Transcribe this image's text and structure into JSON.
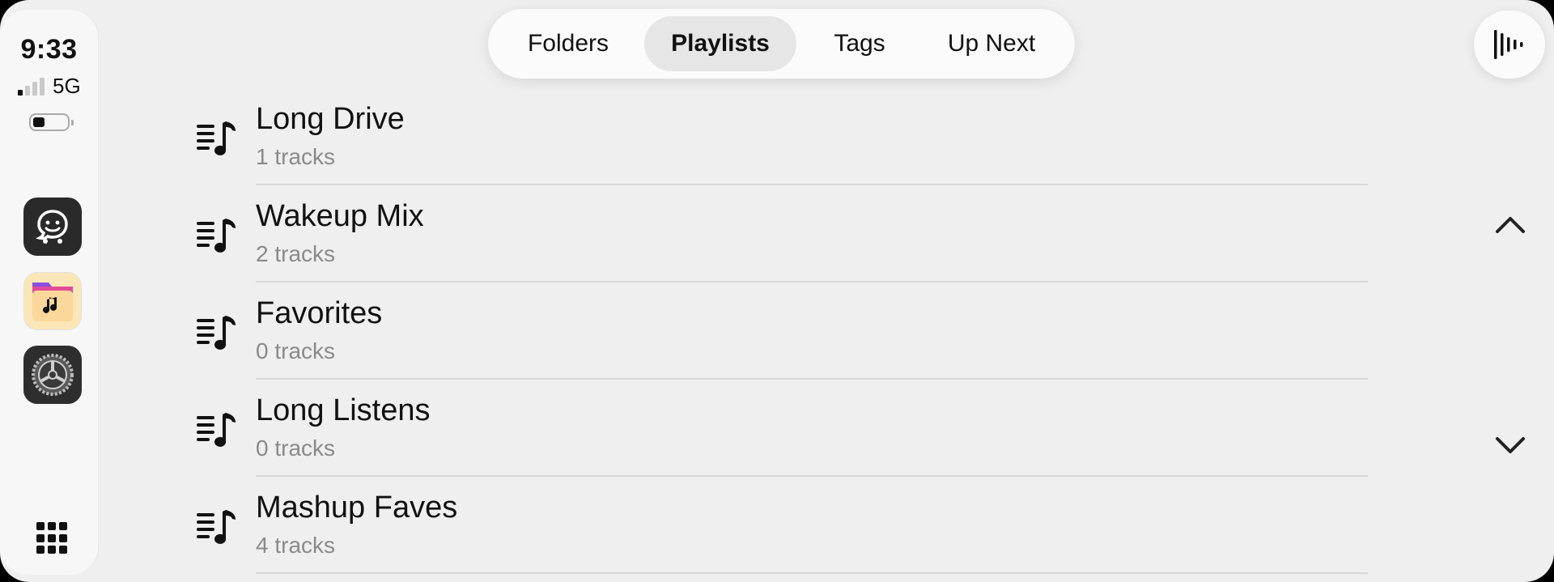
{
  "status": {
    "time": "9:33",
    "network": "5G"
  },
  "dock": {
    "apps": [
      {
        "name": "Waze",
        "icon": "waze-icon"
      },
      {
        "name": "Music Folders",
        "icon": "music-folder-icon"
      },
      {
        "name": "Settings",
        "icon": "settings-gear-icon"
      }
    ]
  },
  "tabs": [
    {
      "label": "Folders",
      "active": false
    },
    {
      "label": "Playlists",
      "active": true
    },
    {
      "label": "Tags",
      "active": false
    },
    {
      "label": "Up Next",
      "active": false
    }
  ],
  "playlists": [
    {
      "title": "Long Drive",
      "subtitle": "1 tracks"
    },
    {
      "title": "Wakeup Mix",
      "subtitle": "2 tracks"
    },
    {
      "title": "Favorites",
      "subtitle": "0 tracks"
    },
    {
      "title": "Long Listens",
      "subtitle": "0 tracks"
    },
    {
      "title": "Mashup Faves",
      "subtitle": "4 tracks"
    }
  ],
  "icons": {
    "playlist": "playlist-icon",
    "now_playing": "now-playing-waveform-icon",
    "scroll_up": "chevron-up-icon",
    "scroll_down": "chevron-down-icon",
    "app_grid": "app-grid-icon"
  }
}
